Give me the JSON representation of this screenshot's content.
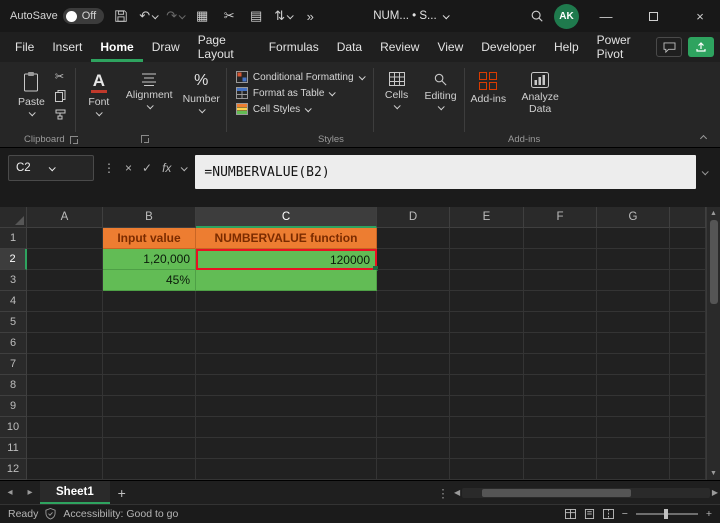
{
  "colors": {
    "accent_green": "#2ea35f",
    "header_fill": "#ED7D31",
    "header_text": "#7b2b00",
    "data_fill": "#62bc55",
    "highlight_red": "#e81123"
  },
  "titlebar": {
    "autosave_label": "AutoSave",
    "autosave_state": "Off",
    "doc_title": "NUM... • S...",
    "avatar_initials": "AK"
  },
  "menubar": {
    "items": [
      "File",
      "Insert",
      "Home",
      "Draw",
      "Page Layout",
      "Formulas",
      "Data",
      "Review",
      "View",
      "Developer",
      "Help",
      "Power Pivot"
    ],
    "active": "Home"
  },
  "ribbon": {
    "paste_label": "Paste",
    "clipboard_group_label": "Clipboard",
    "font_label": "Font",
    "alignment_label": "Alignment",
    "number_label": "Number",
    "conditional_formatting_label": "Conditional Formatting",
    "format_as_table_label": "Format as Table",
    "cell_styles_label": "Cell Styles",
    "styles_group_label": "Styles",
    "cells_label": "Cells",
    "editing_label": "Editing",
    "addins_label": "Add-ins",
    "addins_group_label": "Add-ins",
    "analyze_data_label": "Analyze Data"
  },
  "formula_bar": {
    "name_box": "C2",
    "formula": "=NUMBERVALUE(B2)"
  },
  "grid": {
    "columns": [
      "A",
      "B",
      "C",
      "D",
      "E",
      "F",
      "G"
    ],
    "row_count": 12,
    "selected_cell": "C2",
    "cells": [
      {
        "ref": "B1",
        "text": "Input value",
        "style": "header"
      },
      {
        "ref": "C1",
        "text": "NUMBERVALUE function",
        "style": "header"
      },
      {
        "ref": "B2",
        "text": "1,20,000",
        "style": "data"
      },
      {
        "ref": "C2",
        "text": "120000",
        "style": "data",
        "highlighted": true
      },
      {
        "ref": "B3",
        "text": "45%",
        "style": "data"
      },
      {
        "ref": "C3",
        "text": "",
        "style": "data"
      }
    ]
  },
  "sheetbar": {
    "tabs": [
      {
        "label": "Sheet1",
        "active": true
      }
    ]
  },
  "statusbar": {
    "mode": "Ready",
    "accessibility": "Accessibility: Good to go"
  },
  "icons": {
    "undo": "↶",
    "redo": "↷",
    "more_commands": "»",
    "board": "▦",
    "cut": "✂",
    "picture": "▤",
    "sort": "⇅",
    "dots": "⋮",
    "cancel": "×",
    "enter": "✓",
    "fx": "fx",
    "font_letter": "A",
    "minimize": "—",
    "close": "×",
    "tab_left": "◂",
    "tab_right": "▸",
    "scroll_left": "◀",
    "scroll_right": "▶",
    "scroll_up": "▲",
    "scroll_down": "▼",
    "add": "+",
    "percent": "%",
    "zoom_out": "−",
    "zoom_in": "+"
  }
}
